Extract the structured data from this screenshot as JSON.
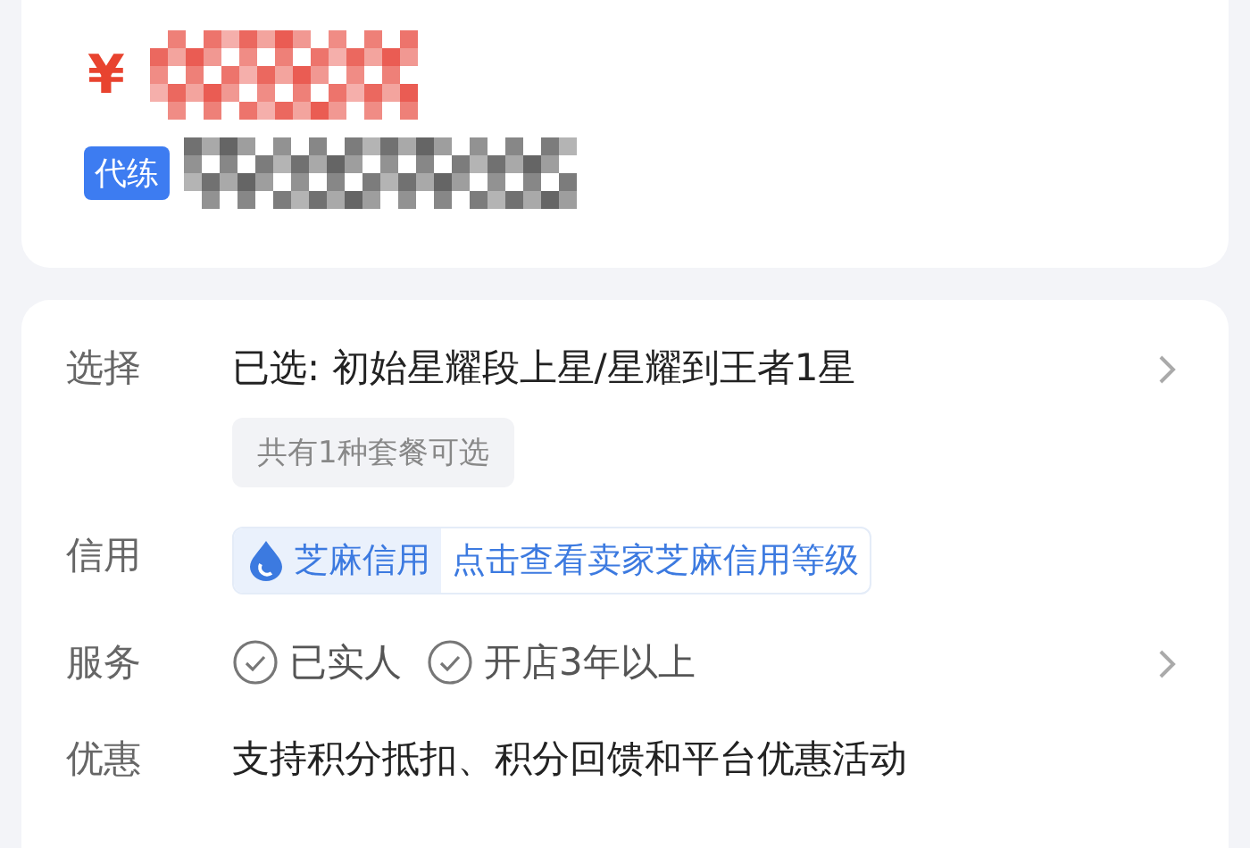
{
  "product": {
    "currency": "¥",
    "tag": "代练"
  },
  "rows": [
    {
      "kind": "selection",
      "label": "选择",
      "value": "已选: 初始星耀段上星/星耀到王者1星",
      "chip": "共有1种套餐可选",
      "has_arrow": true
    },
    {
      "kind": "credit",
      "label": "信用",
      "badge": "芝麻信用",
      "link": "点击查看卖家芝麻信用等级"
    },
    {
      "kind": "service",
      "label": "服务",
      "items": [
        "已实人",
        "开店3年以上"
      ],
      "has_arrow": true
    },
    {
      "kind": "text",
      "label": "优惠",
      "value": "支持积分抵扣、积分回馈和平台优惠活动"
    }
  ]
}
